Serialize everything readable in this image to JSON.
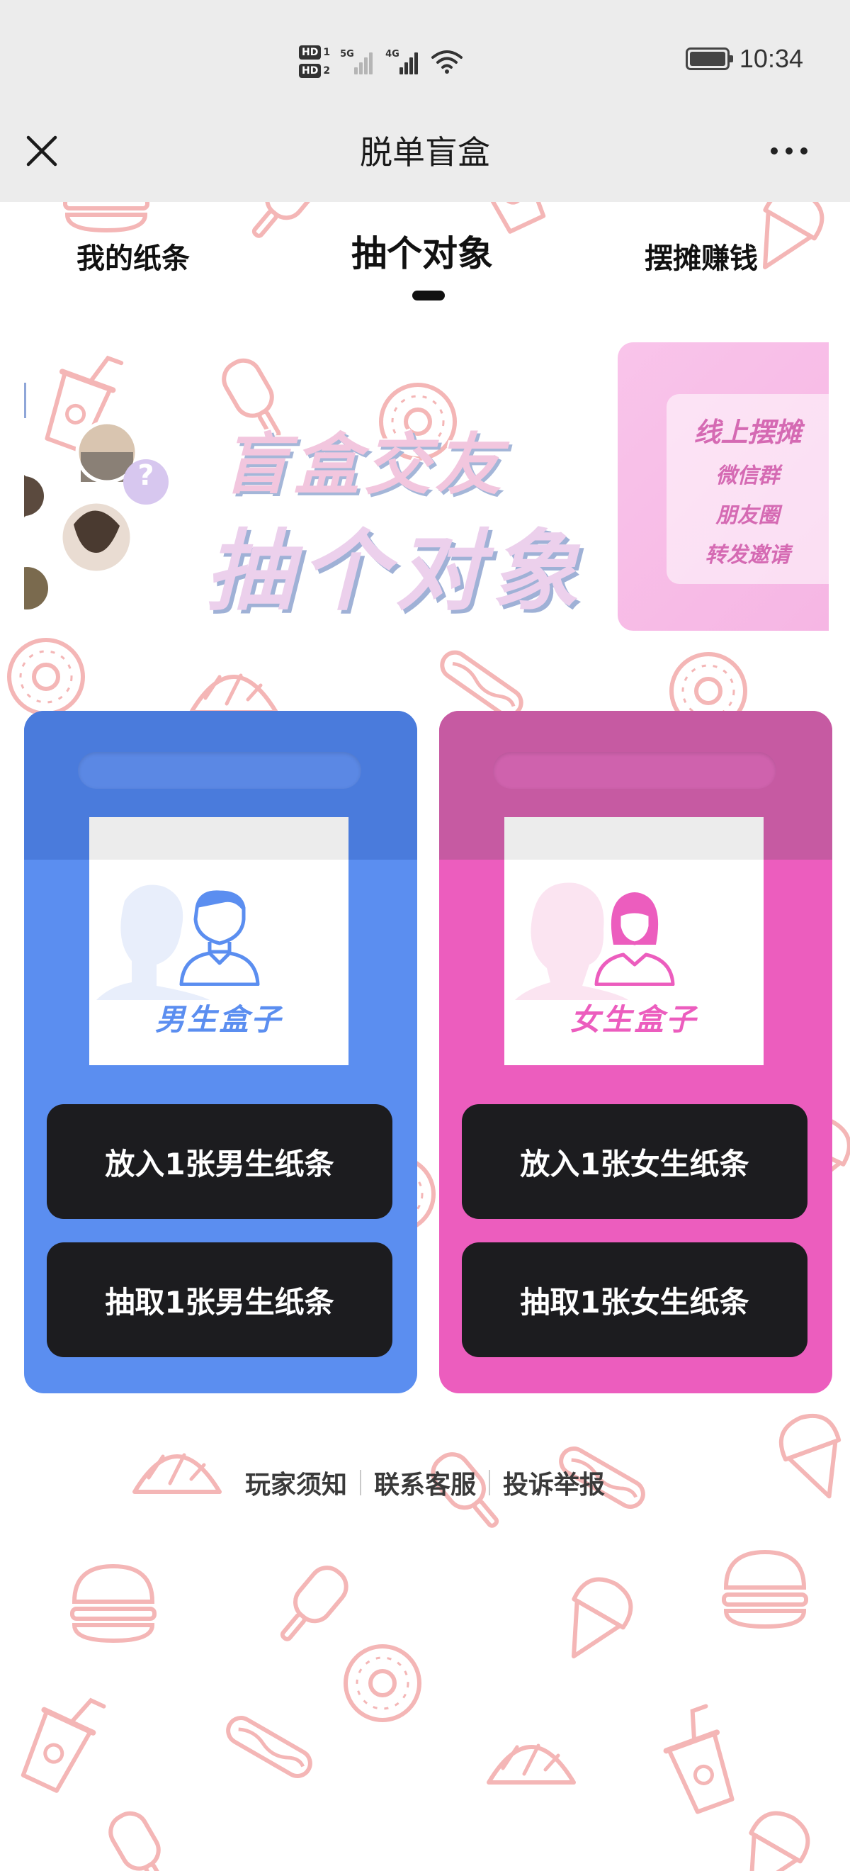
{
  "status_bar": {
    "sim1": "HD",
    "sim1_num": "1",
    "sim2": "HD",
    "sim2_num": "2",
    "net1": "5G",
    "net2": "4G",
    "time": "10:34"
  },
  "title_bar": {
    "title": "脱单盲盒"
  },
  "tabs": [
    {
      "label": "我的纸条"
    },
    {
      "label": "抽个对象"
    },
    {
      "label": "摆摊赚钱"
    }
  ],
  "active_tab_index": 1,
  "banner": {
    "title_line1": "盲盒交友",
    "title_line2": "抽个对象",
    "question_mark": "?",
    "promo_title": "线上摆摊",
    "promo_lines": [
      "微信群",
      "朋友圈",
      "转发邀请"
    ]
  },
  "male_card": {
    "box_label": "男生盒子",
    "put_button": "放入1张男生纸条",
    "draw_button": "抽取1张男生纸条",
    "color": "#5b8ef0"
  },
  "female_card": {
    "box_label": "女生盒子",
    "put_button": "放入1张女生纸条",
    "draw_button": "抽取1张女生纸条",
    "color": "#ec5dbe"
  },
  "footer": {
    "links": [
      "玩家须知",
      "联系客服",
      "投诉举报"
    ]
  },
  "colors": {
    "pattern": "#f4b6b6",
    "button": "#1c1c1f"
  }
}
